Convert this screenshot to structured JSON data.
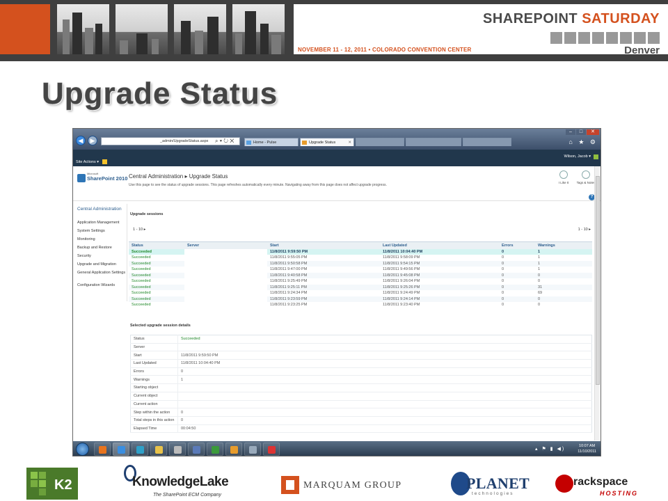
{
  "banner": {
    "event_date": "NOVEMBER 11 - 12, 2011  •  COLORADO CONVENTION CENTER",
    "logo_part1": "SHAREPOINT",
    "logo_part2": "SATURDAY",
    "city": "Denver",
    "accent_color": "#d4511e"
  },
  "slide": {
    "title": "Upgrade Status"
  },
  "browser": {
    "address": "_admin/UpgradeStatus.aspx",
    "address_icons": "⌕ ▾ ↻ ✕",
    "tabs": [
      {
        "label": "Home - Pulse"
      },
      {
        "label": "Upgrade Status"
      }
    ],
    "window_controls": [
      "–",
      "□",
      "✕"
    ]
  },
  "sharepoint": {
    "site_actions": "Site Actions ▾",
    "user": "Wilson, Jacob ▾",
    "logo_small": "Microsoft",
    "logo_text": "SharePoint 2010",
    "breadcrumb_root": "Central Administration",
    "breadcrumb_sep": " ▸ ",
    "breadcrumb_page": "Upgrade Status",
    "page_description": "Use this page to see the status of upgrade sessions. This page refreshes automatically every minute. Navigating away from this page does not affect upgrade progress.",
    "tools": [
      {
        "label": "I Like It"
      },
      {
        "label": "Tags & Notes"
      }
    ],
    "help": "?"
  },
  "left_nav": {
    "heading": "Central Administration",
    "items": [
      "Application Management",
      "System Settings",
      "Monitoring",
      "Backup and Restore",
      "Security",
      "Upgrade and Migration",
      "General Application Settings",
      "Configuration Wizards"
    ]
  },
  "sessions": {
    "title": "Upgrade sessions",
    "pager": "1 - 10 ▸",
    "columns": [
      "Status",
      "Server",
      "Start",
      "Last Updated",
      "Errors",
      "Warnings"
    ],
    "rows": [
      [
        "Succeeded",
        "",
        "11/8/2011 9:59:50 PM",
        "11/8/2011 10:04:40 PM",
        "0",
        "1"
      ],
      [
        "Succeeded",
        "",
        "11/8/2011 9:55:05 PM",
        "11/8/2011 9:58:09 PM",
        "0",
        "1"
      ],
      [
        "Succeeded",
        "",
        "11/8/2011 9:50:58 PM",
        "11/8/2011 9:54:15 PM",
        "0",
        "1"
      ],
      [
        "Succeeded",
        "",
        "11/8/2011 9:47:00 PM",
        "11/8/2011 9:49:56 PM",
        "0",
        "1"
      ],
      [
        "Succeeded",
        "",
        "11/8/2011 9:40:58 PM",
        "11/8/2011 9:45:08 PM",
        "0",
        "0"
      ],
      [
        "Succeeded",
        "",
        "11/8/2011 9:25:49 PM",
        "11/8/2011 9:26:04 PM",
        "0",
        "0"
      ],
      [
        "Succeeded",
        "",
        "11/8/2011 9:25:11 PM",
        "11/8/2011 9:25:26 PM",
        "0",
        "31"
      ],
      [
        "Succeeded",
        "",
        "11/8/2011 9:24:34 PM",
        "11/8/2011 9:24:49 PM",
        "0",
        "69"
      ],
      [
        "Succeeded",
        "",
        "11/8/2011 9:23:59 PM",
        "11/8/2011 9:24:14 PM",
        "0",
        "0"
      ],
      [
        "Succeeded",
        "",
        "11/8/2011 9:23:25 PM",
        "11/8/2011 9:23:40 PM",
        "0",
        "0"
      ]
    ]
  },
  "details": {
    "title": "Selected upgrade session details",
    "rows": [
      [
        "Status",
        "Succeeded"
      ],
      [
        "Server",
        ""
      ],
      [
        "Start",
        "11/8/2011 9:59:50 PM"
      ],
      [
        "Last Updated",
        "11/8/2011 10:04:40 PM"
      ],
      [
        "Errors",
        "0"
      ],
      [
        "Warnings",
        "1"
      ],
      [
        "Starting object",
        ""
      ],
      [
        "Current object",
        ""
      ],
      [
        "Current action",
        ""
      ],
      [
        "Step within the action",
        "0"
      ],
      [
        "Total steps in this action",
        "0"
      ],
      [
        "Elapsed Time",
        "00:04:50"
      ]
    ]
  },
  "taskbar": {
    "tray": "▴ ⚑ ▮ ◀)",
    "time": "10:07 AM",
    "date": "11/10/2011"
  },
  "sponsors": {
    "k2": "K2",
    "knowledgelake": "KnowledgeLake",
    "knowledgelake_tag": "The SharePoint ECM Company",
    "marquam": "MARQUAM GROUP",
    "planet": "PLANET",
    "planet_tag": "technologies",
    "rackspace": "rackspace",
    "rackspace_tag": "HOSTING"
  }
}
